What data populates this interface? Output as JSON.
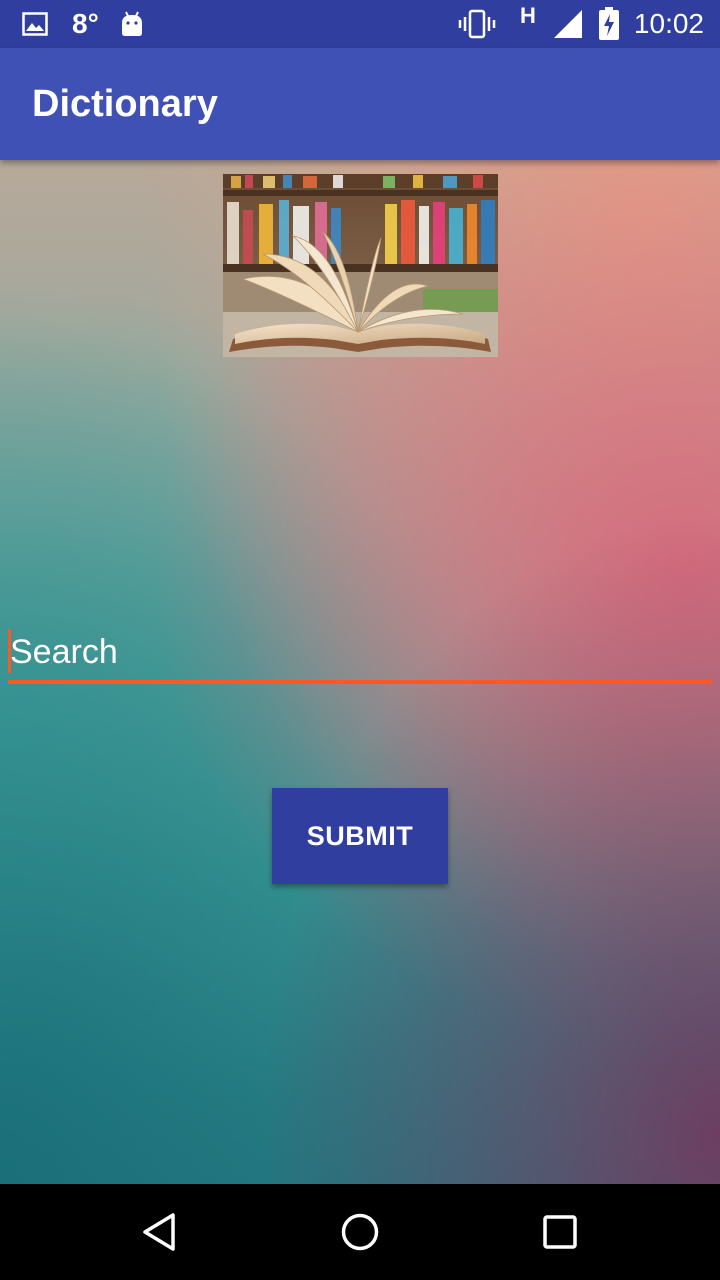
{
  "status_bar": {
    "temperature": "8°",
    "time": "10:02",
    "network_type": "H",
    "icons": [
      "image-icon",
      "android-icon",
      "vibrate-icon",
      "signal-icon",
      "battery-charging-icon"
    ]
  },
  "app_bar": {
    "title": "Dictionary"
  },
  "main": {
    "image": {
      "semantic": "open-book-bookshelf"
    },
    "search": {
      "placeholder": "Search",
      "value": ""
    },
    "submit_label": "SUBMIT"
  },
  "nav_bar": {
    "icons": [
      "back-icon",
      "home-icon",
      "recents-icon"
    ]
  },
  "colors": {
    "primary": "#3F51B5",
    "primary_dark": "#303F9F",
    "accent": "#FF5722"
  }
}
